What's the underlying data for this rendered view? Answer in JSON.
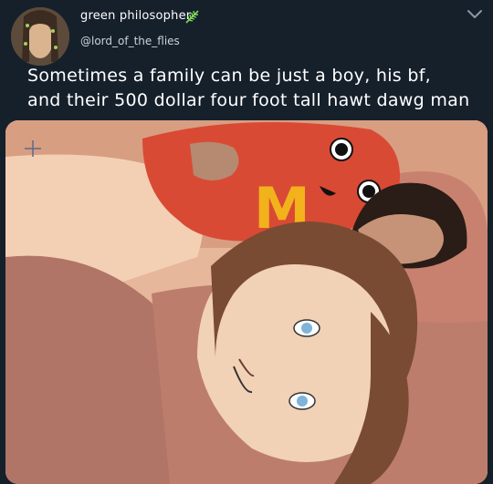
{
  "tweet": {
    "display_name": "green philosopher",
    "display_name_emoji": "leaf-icon",
    "handle": "@lord_of_the_flies",
    "text_lines": [
      "Sometimes a family can be just a boy, his bf,",
      "and their 500 dollar four foot tall hawt dawg man"
    ]
  },
  "media": {
    "description_icon": "artwork-image",
    "mascot_letter": "M"
  },
  "colors": {
    "background": "#15202b",
    "text": "#ffffff",
    "handle": "#c9d2dc",
    "leaf": "#7ed957",
    "mascot_red": "#d94a34",
    "mascot_yellow": "#f2b21b"
  }
}
